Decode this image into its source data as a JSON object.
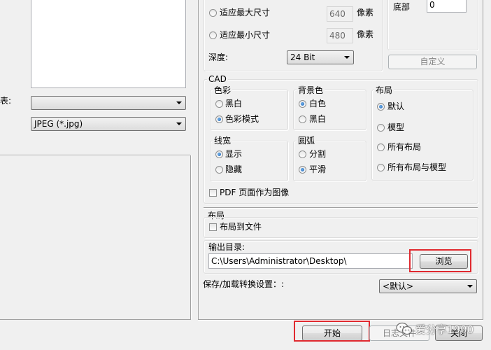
{
  "size_group": {
    "fit_max_label": "适应最大尺寸",
    "fit_max_value": "640",
    "fit_max_unit": "像素",
    "fit_min_label": "适应最小尺寸",
    "fit_min_value": "480",
    "fit_min_unit": "像素",
    "depth_label": "深度:",
    "depth_value": "24 Bit"
  },
  "margin_group": {
    "bottom_label": "底部",
    "bottom_value": "0",
    "custom_button": "自定义"
  },
  "left_panel": {
    "partial_label": "表:",
    "combo1_value": "",
    "format_value": "JPEG (*.jpg)"
  },
  "cad": {
    "title": "CAD",
    "color": {
      "title": "色彩",
      "options": [
        "黑白",
        "色彩模式"
      ],
      "selected": 1
    },
    "background": {
      "title": "背景色",
      "options": [
        "白色",
        "黑白"
      ],
      "selected": 0
    },
    "layout": {
      "title": "布局",
      "options": [
        "默认",
        "模型",
        "所有布局",
        "所有布局与模型"
      ],
      "selected": 0
    },
    "linewidth": {
      "title": "线宽",
      "options": [
        "显示",
        "隐藏"
      ],
      "selected": 0
    },
    "arc": {
      "title": "圆弧",
      "options": [
        "分割",
        "平滑"
      ],
      "selected": 1
    },
    "pdf_checkbox": "PDF 页面作为图像"
  },
  "layout_section": {
    "title": "布局",
    "to_file_checkbox": "布局到文件"
  },
  "output": {
    "label": "输出目录:",
    "path": "C:\\Users\\Administrator\\Desktop\\",
    "browse_button": "浏览"
  },
  "save_settings": {
    "label": "保存/加载转换设置：:",
    "value": "<默认>"
  },
  "footer": {
    "start_button": "开始",
    "log_button": "日志文件",
    "close_button": "关闭",
    "watermark": "爱分享1990"
  },
  "colors": {
    "highlight_red": "#e0292f",
    "radio_selected": "#1a5fb4"
  }
}
